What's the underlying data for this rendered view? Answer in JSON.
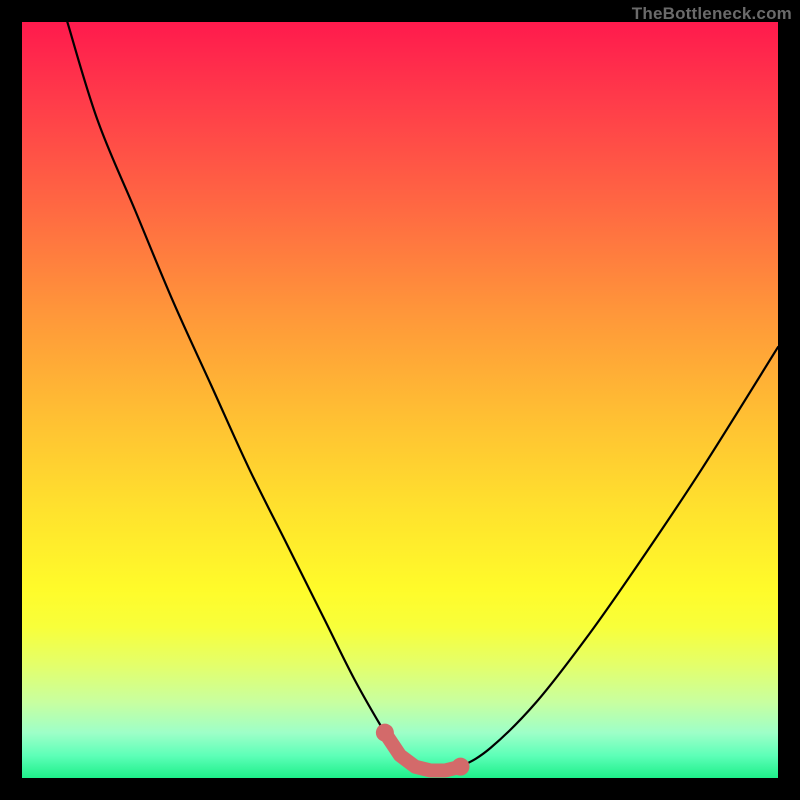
{
  "watermark": "TheBottleneck.com",
  "colors": {
    "curve_stroke": "#000000",
    "marker_stroke": "#d36a6a",
    "marker_fill": "#d36a6a",
    "background": "#000000"
  },
  "chart_data": {
    "type": "line",
    "title": "",
    "xlabel": "",
    "ylabel": "",
    "xlim": [
      0,
      100
    ],
    "ylim": [
      0,
      100
    ],
    "grid": false,
    "legend": false,
    "series": [
      {
        "name": "bottleneck-curve",
        "x": [
          6,
          10,
          15,
          20,
          25,
          30,
          35,
          40,
          44,
          48,
          50,
          52,
          54,
          56,
          58,
          62,
          68,
          75,
          82,
          90,
          100
        ],
        "y": [
          100,
          87,
          75,
          63,
          52,
          41,
          31,
          21,
          13,
          6,
          3,
          1.5,
          1,
          1,
          1.5,
          4,
          10,
          19,
          29,
          41,
          57
        ]
      }
    ],
    "annotations": [
      {
        "name": "optimal-range-markers",
        "x": [
          48,
          50,
          52,
          54,
          56,
          58
        ],
        "y": [
          6,
          3,
          1.5,
          1,
          1,
          1.5
        ]
      }
    ]
  }
}
